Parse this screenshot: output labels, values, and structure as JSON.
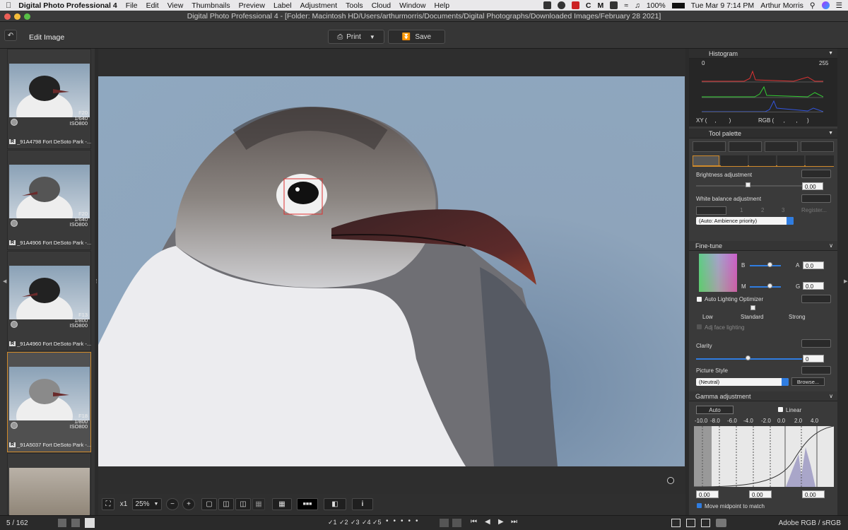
{
  "menubar": {
    "app": "Digital Photo Professional 4",
    "items": [
      "File",
      "Edit",
      "View",
      "Thumbnails",
      "Preview",
      "Label",
      "Adjustment",
      "Tools",
      "Cloud",
      "Window",
      "Help"
    ],
    "battery": "100%",
    "clock": "Tue Mar 9  7:14 PM",
    "user": "Arthur Morris"
  },
  "window": {
    "title": "Digital Photo Professional 4 - [Folder: Macintosh HD/Users/arthurmorris/Documents/Digital Photographs/Downloaded Images/February 28 2021]"
  },
  "toolbar": {
    "edit_image": "Edit Image",
    "print": "Print",
    "save": "Save"
  },
  "thumbnails": [
    {
      "aperture": "F20",
      "shutter": "1/640",
      "iso": "ISO800",
      "badge": "R",
      "name": "_91A4798 Fort DeSoto Park -...",
      "selected": false
    },
    {
      "aperture": "F20",
      "shutter": "1/640",
      "iso": "ISO800",
      "badge": "R",
      "name": "_91A4906 Fort DeSoto Park -...",
      "selected": false
    },
    {
      "aperture": "F13",
      "shutter": "1/800",
      "iso": "ISO800",
      "badge": "R",
      "name": "_91A4960 Fort DeSoto Park -...",
      "selected": false
    },
    {
      "aperture": "F18",
      "shutter": "1/800",
      "iso": "ISO800",
      "badge": "R",
      "name": "_91A5037 Fort DeSoto Park -...",
      "selected": true
    }
  ],
  "viewer_toolbar": {
    "zoom_x1": "x1",
    "zoom_pct": "25%"
  },
  "status": {
    "count": "5 / 162",
    "colorspace": "Adobe RGB / sRGB",
    "checkmarks": [
      "1",
      "2",
      "3",
      "4",
      "5"
    ]
  },
  "histogram": {
    "title": "Histogram",
    "min": "0",
    "max": "255",
    "xy_label": "XY (",
    "xy_sep": ",",
    "xy_close": ")",
    "rgb_label": "RGB (",
    "rgb_sep1": ",",
    "rgb_sep2": ",",
    "rgb_close": ")"
  },
  "tool_palette": {
    "title": "Tool palette",
    "brightness_label": "Brightness adjustment",
    "brightness_value": "0.00",
    "wb_label": "White balance adjustment",
    "wb_presets": [
      "1",
      "2",
      "3"
    ],
    "wb_register": "Register...",
    "wb_mode": "(Auto: Ambience priority)",
    "finetune_label": "Fine-tune",
    "ft_b": "B",
    "ft_a": "A",
    "ft_m": "M",
    "ft_g": "G",
    "ft_a_value": "0.0",
    "ft_g_value": "0.0",
    "alo_label": "Auto Lighting Optimizer",
    "alo_low": "Low",
    "alo_standard": "Standard",
    "alo_strong": "Strong",
    "adj_face": "Adj face lighting",
    "clarity_label": "Clarity",
    "clarity_value": "0",
    "picture_style_label": "Picture Style",
    "picture_style_value": "(Neutral)",
    "browse": "Browse...",
    "gamma_label": "Gamma adjustment",
    "auto": "Auto",
    "linear": "Linear",
    "gamma_ticks": [
      "-10.0",
      "-8.0",
      "-6.0",
      "-4.0",
      "-2.0",
      "0.0",
      "2.0",
      "4.0"
    ],
    "gamma_values": [
      "0.00",
      "0.00",
      "0.00"
    ],
    "midpoint": "Move midpoint to match"
  },
  "colors": {
    "accent": "#d08a2a",
    "blue": "#2f7de1"
  }
}
